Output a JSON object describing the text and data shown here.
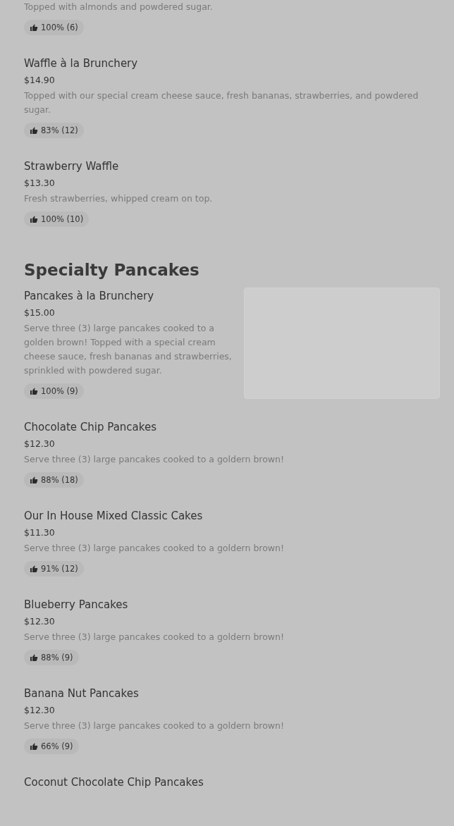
{
  "top_items": [
    {
      "description": "Topped with almonds and powdered sugar.",
      "rating": "100% (6)"
    },
    {
      "name": "Waffle à la Brunchery",
      "price": "$14.90",
      "description": "Topped with our special cream cheese sauce, fresh bananas, strawberries, and powdered sugar.",
      "rating": "83% (12)"
    },
    {
      "name": "Strawberry Waffle",
      "price": "$13.30",
      "description": "Fresh strawberries, whipped cream on top.",
      "rating": "100% (10)"
    }
  ],
  "sections": [
    {
      "heading": "Specialty Pancakes",
      "items": [
        {
          "name": "Pancakes à la Brunchery",
          "price": "$15.00",
          "description": "Serve three (3) large pancakes cooked to a golden brown! Topped with a special cream cheese sauce, fresh bananas and strawberries, sprinkled with powdered sugar.",
          "rating": "100% (9)",
          "image_placeholder": true
        },
        {
          "name": "Chocolate Chip Pancakes",
          "price": "$12.30",
          "description": "Serve three (3) large pancakes cooked to a goldern brown!",
          "rating": "88% (18)"
        },
        {
          "name": "Our In House Mixed Classic Cakes",
          "price": "$11.30",
          "description": "Serve three (3) large pancakes cooked to a goldern brown!",
          "rating": "91% (12)"
        },
        {
          "name": "Blueberry Pancakes",
          "price": "$12.30",
          "description": "Serve three (3) large pancakes cooked to a goldern brown!",
          "rating": "88% (9)"
        },
        {
          "name": "Banana Nut Pancakes",
          "price": "$12.30",
          "description": "Serve three (3) large pancakes cooked to a goldern brown!",
          "rating": "66% (9)"
        },
        {
          "name": "Coconut Chocolate Chip Pancakes"
        }
      ]
    }
  ]
}
